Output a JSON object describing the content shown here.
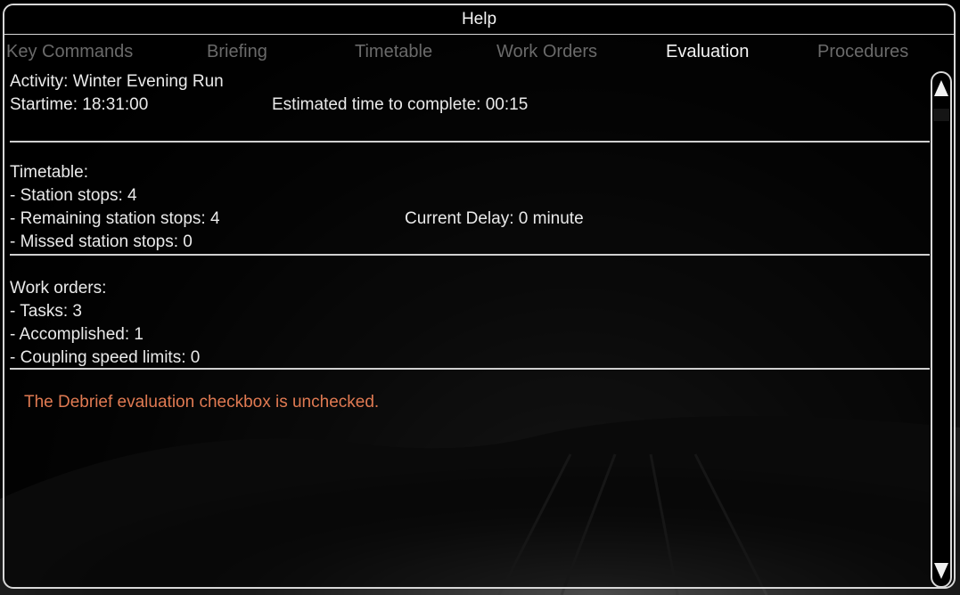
{
  "window": {
    "title": "Help"
  },
  "tabs": [
    {
      "label": "Key Commands",
      "active": false
    },
    {
      "label": "Briefing",
      "active": false
    },
    {
      "label": "Timetable",
      "active": false
    },
    {
      "label": "Work Orders",
      "active": false
    },
    {
      "label": "Evaluation",
      "active": true
    },
    {
      "label": "Procedures",
      "active": false
    }
  ],
  "evaluation": {
    "activity": "Activity: Winter Evening Run",
    "starttime": "Startime: 18:31:00",
    "estimated": "Estimated time to complete: 00:15",
    "timetable": {
      "heading": "Timetable:",
      "station_stops": "- Station stops: 4",
      "remaining_stops": "- Remaining station stops: 4",
      "current_delay": "Current Delay: 0 minute",
      "missed_stops": "- Missed station stops: 0"
    },
    "work_orders": {
      "heading": "Work orders:",
      "tasks": "- Tasks: 3",
      "accomplished": "- Accomplished: 1",
      "coupling_limits": "- Coupling speed limits: 0"
    },
    "debrief_notice": "The Debrief evaluation checkbox is unchecked."
  },
  "colors": {
    "text": "#eaeaea",
    "inactive_tab": "#6a6a6a",
    "active_tab": "#f4f4f4",
    "notice": "#e07a52",
    "border": "#d8d8d8"
  },
  "icons": {
    "scroll_up": "triangle-up-icon",
    "scroll_down": "triangle-down-icon"
  }
}
